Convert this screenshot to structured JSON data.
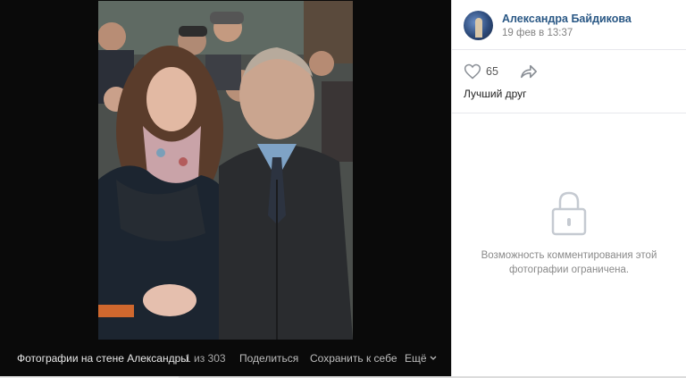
{
  "viewer": {
    "album_title": "Фотографии на стене Александры",
    "counter": "1 из 303",
    "share_label": "Поделиться",
    "save_label": "Сохранить к себе",
    "more_label": "Ещё"
  },
  "post": {
    "author_name": "Александра Байдикова",
    "date": "19 фев в 13:37",
    "likes": "65",
    "caption": "Лучший друг",
    "comments_restricted": "Возможность комментирования этой фотографии ограничена."
  },
  "colors": {
    "link": "#2a5885",
    "viewer_bg": "#0a0a0a"
  },
  "icons": [
    "heart-icon",
    "share-arrow-icon",
    "lock-icon",
    "chevron-down-icon"
  ]
}
